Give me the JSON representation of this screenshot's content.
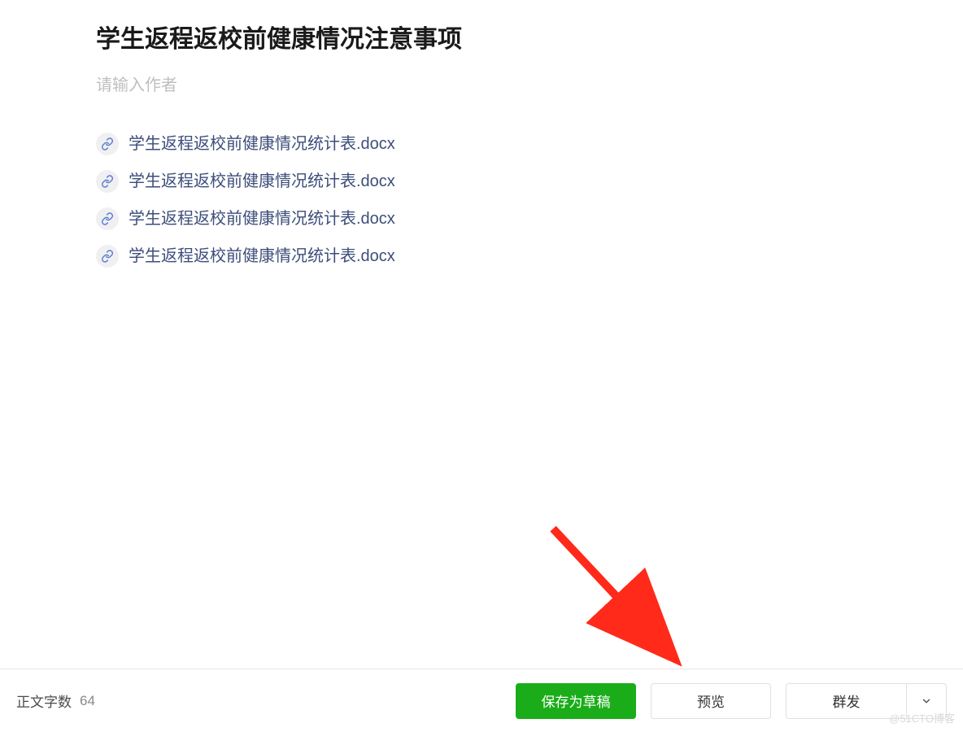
{
  "title": "学生返程返校前健康情况注意事项",
  "author_placeholder": "请输入作者",
  "attachments": [
    {
      "name": "学生返程返校前健康情况统计表.docx"
    },
    {
      "name": "学生返程返校前健康情况统计表.docx"
    },
    {
      "name": "学生返程返校前健康情况统计表.docx"
    },
    {
      "name": "学生返程返校前健康情况统计表.docx"
    }
  ],
  "footer": {
    "word_count_label": "正文字数",
    "word_count_value": "64",
    "save_draft_label": "保存为草稿",
    "preview_label": "预览",
    "publish_label": "群发"
  },
  "watermark": "@51CTO博客"
}
